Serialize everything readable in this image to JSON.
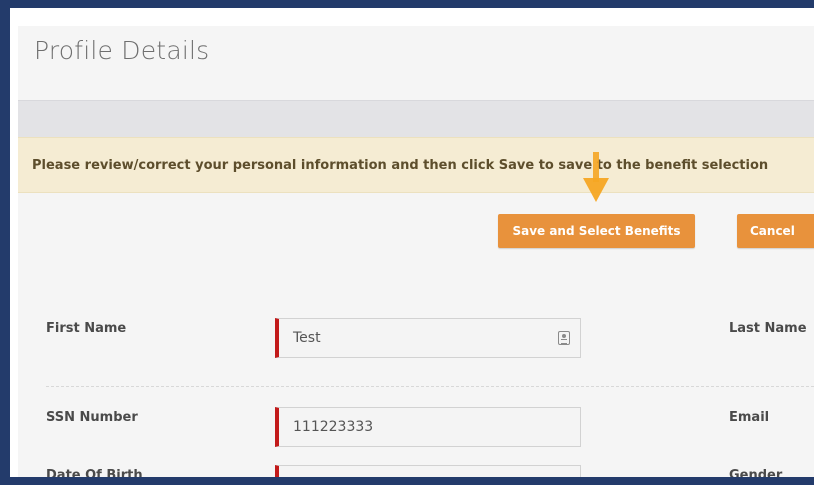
{
  "page": {
    "title": "Profile Details"
  },
  "notice": {
    "text": "Please review/correct your personal information and then click Save to save to the benefit selection"
  },
  "actions": {
    "save_label": "Save and Select Benefits",
    "cancel_label": "Cancel"
  },
  "form": {
    "first_name": {
      "label": "First Name",
      "value": "Test"
    },
    "last_name": {
      "label": "Last Name"
    },
    "ssn": {
      "label": "SSN Number",
      "value": "111223333"
    },
    "email": {
      "label": "Email"
    },
    "dob": {
      "label": "Date Of Birth"
    },
    "gender": {
      "label": "Gender"
    }
  },
  "colors": {
    "accent": "#e8923c",
    "required": "#c21a1a",
    "arrow": "#f5a623",
    "notice_bg": "#f5ecd3",
    "frame": "#233b6b"
  }
}
